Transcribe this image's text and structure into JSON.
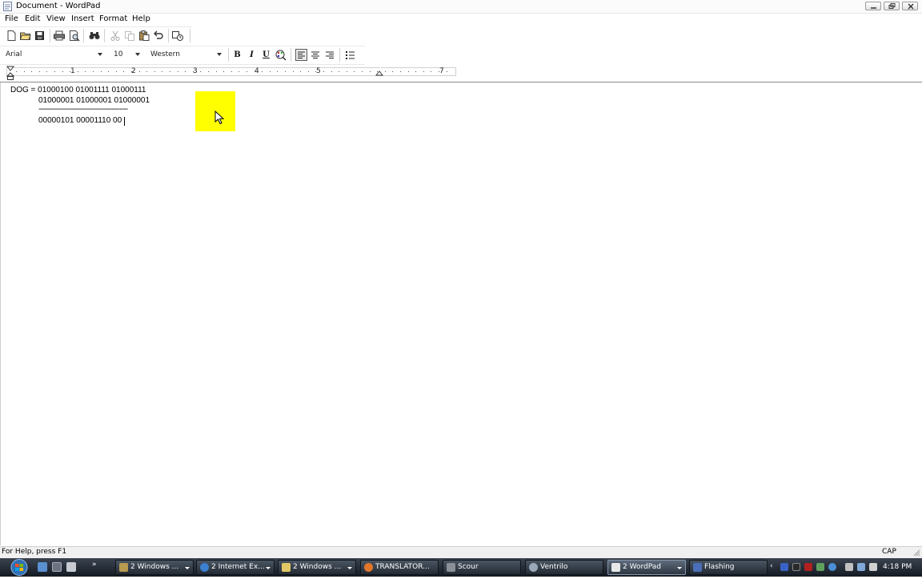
{
  "window": {
    "title": "Document - WordPad"
  },
  "menu": [
    "File",
    "Edit",
    "View",
    "Insert",
    "Format",
    "Help"
  ],
  "toolbar": {
    "icons": [
      "new-icon",
      "open-icon",
      "save-icon",
      "print-icon",
      "print-preview-icon",
      "find-icon",
      "cut-icon",
      "copy-icon",
      "paste-icon",
      "undo-icon",
      "insert-datetime-icon"
    ]
  },
  "format_bar": {
    "font_name": "Arial",
    "font_size": "10",
    "script": "Western",
    "bold_label": "B",
    "italic_label": "I",
    "underline_label": "U"
  },
  "ruler": {
    "numbers": [
      "1",
      "2",
      "3",
      "4",
      "5",
      "6",
      "7"
    ]
  },
  "document": {
    "lines": [
      "DOG = 01000100 01001111 01000111",
      "01000001 01000001 01000001",
      "--------------------------------------------",
      "00000101 00001110 00"
    ]
  },
  "status": {
    "help_text": "For Help, press F1",
    "cap": "CAP"
  },
  "taskbar": {
    "buttons": [
      {
        "label": "2 Windows ...",
        "active": false
      },
      {
        "label": "2 Internet Ex...",
        "active": false
      },
      {
        "label": "2 Windows ...",
        "active": false
      },
      {
        "label": "TRANSLATOR...",
        "active": false
      },
      {
        "label": "Scour",
        "active": false
      },
      {
        "label": "Ventrilo",
        "active": false
      },
      {
        "label": "2 WordPad",
        "active": true
      },
      {
        "label": "Flashing",
        "active": false
      }
    ],
    "clock": "4:18 PM"
  },
  "colors": {
    "highlight": "#ffff00",
    "taskbar": "#1f2630"
  }
}
